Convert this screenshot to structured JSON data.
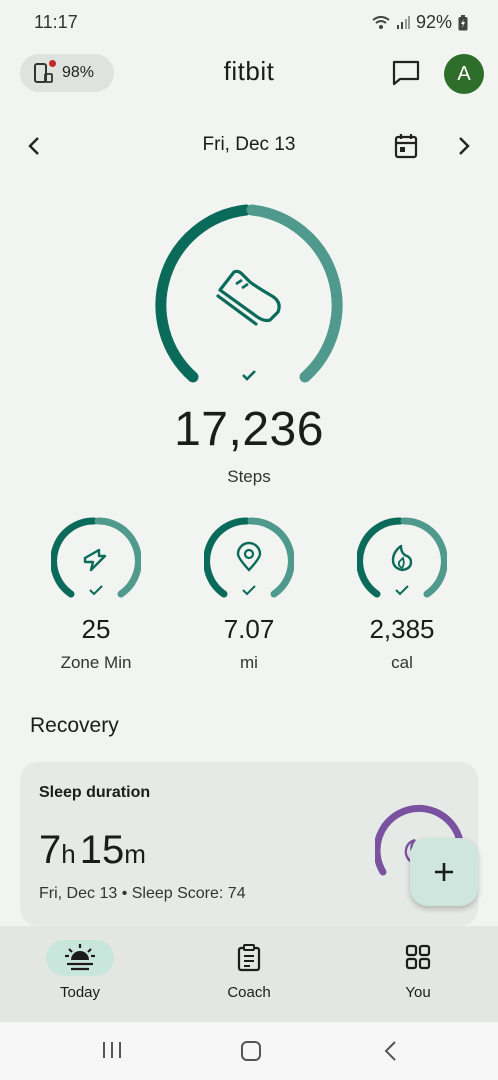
{
  "status_bar": {
    "time": "11:17",
    "battery": "92%"
  },
  "header": {
    "device_battery": "98%",
    "app_title": "fitbit",
    "avatar_initial": "A"
  },
  "date_nav": {
    "label": "Fri, Dec 13"
  },
  "steps": {
    "value": "17,236",
    "label": "Steps",
    "goal_progress": 1.0
  },
  "stats": [
    {
      "value": "25",
      "label": "Zone Min",
      "icon": "zone-arrow-icon"
    },
    {
      "value": "7.07",
      "label": "mi",
      "icon": "location-pin-icon"
    },
    {
      "value": "2,385",
      "label": "cal",
      "icon": "flame-icon"
    }
  ],
  "recovery": {
    "section_title": "Recovery",
    "sleep_card": {
      "title": "Sleep duration",
      "hours": "7",
      "hours_unit": "h",
      "minutes": "15",
      "minutes_unit": "m",
      "subtitle": "Fri, Dec 13 • Sleep Score: 74"
    }
  },
  "bottom_nav": [
    {
      "label": "Today",
      "active": true
    },
    {
      "label": "Coach",
      "active": false
    },
    {
      "label": "You",
      "active": false
    }
  ],
  "colors": {
    "accent_dark": "#0b6b5a",
    "accent_light": "#4f9a8c",
    "sleep_purple": "#7a52a0",
    "avatar_green": "#2f6d2a"
  }
}
